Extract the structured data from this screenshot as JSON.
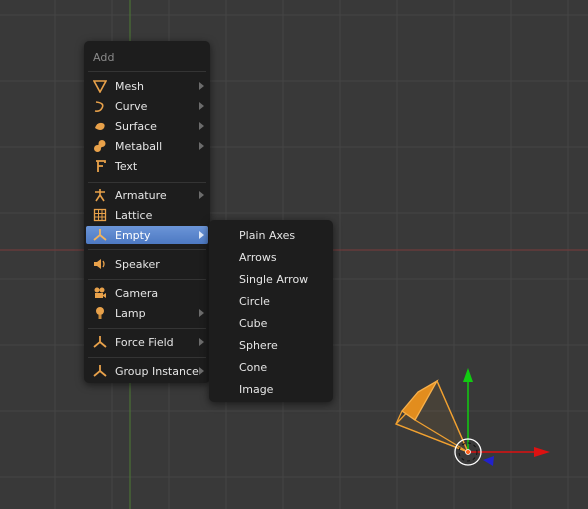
{
  "add_menu": {
    "title": "Add",
    "items": [
      {
        "label": "Mesh",
        "icon": "mesh-icon"
      },
      {
        "label": "Curve",
        "icon": "curve-icon"
      },
      {
        "label": "Surface",
        "icon": "surface-icon"
      },
      {
        "label": "Metaball",
        "icon": "metaball-icon"
      },
      {
        "label": "Text",
        "icon": "text-icon"
      },
      {
        "label": "Armature",
        "icon": "armature-icon"
      },
      {
        "label": "Lattice",
        "icon": "lattice-icon"
      },
      {
        "label": "Empty",
        "icon": "empty-icon"
      },
      {
        "label": "Speaker",
        "icon": "speaker-icon"
      },
      {
        "label": "Camera",
        "icon": "camera-icon"
      },
      {
        "label": "Lamp",
        "icon": "lamp-icon"
      },
      {
        "label": "Force Field",
        "icon": "force-field-icon"
      },
      {
        "label": "Group Instance",
        "icon": "group-instance-icon"
      }
    ]
  },
  "empty_submenu": {
    "items": [
      {
        "label": "Plain Axes"
      },
      {
        "label": "Arrows"
      },
      {
        "label": "Single Arrow"
      },
      {
        "label": "Circle"
      },
      {
        "label": "Cube"
      },
      {
        "label": "Sphere"
      },
      {
        "label": "Cone"
      },
      {
        "label": "Image"
      }
    ]
  },
  "colors": {
    "viewport_bg": "#393939",
    "grid": "#454545",
    "x_axis": "#7a3a3a",
    "y_axis": "#4d7a34",
    "menu_bg": "#1d1d1d",
    "highlight": "#5680c9",
    "icon_orange": "#e8a14a",
    "camera_orange": "#f0a030",
    "gizmo_red": "#dd1111",
    "gizmo_green": "#11cc11",
    "gizmo_blue": "#2222cc"
  }
}
